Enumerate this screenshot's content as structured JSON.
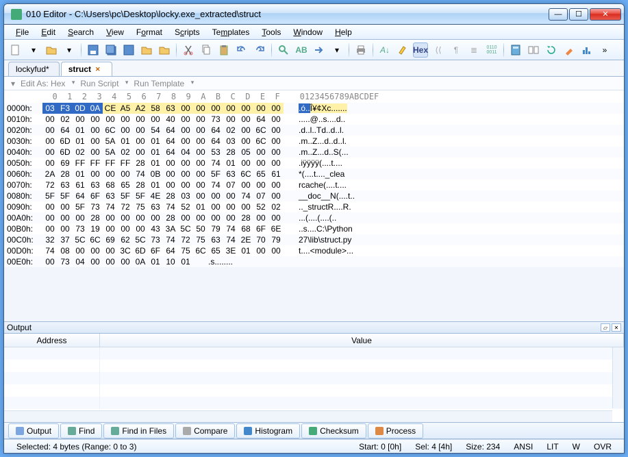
{
  "title": "010 Editor - C:\\Users\\pc\\Desktop\\locky.exe_extracted\\struct",
  "menu": [
    "File",
    "Edit",
    "Search",
    "View",
    "Format",
    "Scripts",
    "Templates",
    "Tools",
    "Window",
    "Help"
  ],
  "tabs": [
    {
      "label": "lockyfud*",
      "active": false,
      "close": true
    },
    {
      "label": "struct",
      "active": true,
      "close": true
    }
  ],
  "options": {
    "editAs": "Edit As: Hex",
    "runScript": "Run Script",
    "runTemplate": "Run Template"
  },
  "hexHeader": "  0  1  2  3  4  5  6  7  8  9  A  B  C  D  E  F    0123456789ABCDEF",
  "hex": [
    {
      "addr": "0000h:",
      "bytes": [
        "03",
        "F3",
        "0D",
        "0A",
        "CE",
        "A5",
        "A2",
        "58",
        "63",
        "00",
        "00",
        "00",
        "00",
        "00",
        "00",
        "00"
      ],
      "ascii": ".ó..Î¥¢Xc......."
    },
    {
      "addr": "0010h:",
      "bytes": [
        "00",
        "02",
        "00",
        "00",
        "00",
        "00",
        "00",
        "00",
        "40",
        "00",
        "00",
        "73",
        "00",
        "00",
        "64",
        "00"
      ],
      "ascii": ".....@..s....d.."
    },
    {
      "addr": "0020h:",
      "bytes": [
        "00",
        "64",
        "01",
        "00",
        "6C",
        "00",
        "00",
        "54",
        "64",
        "00",
        "00",
        "64",
        "02",
        "00",
        "6C",
        "00"
      ],
      "ascii": ".d..l..Td..d..l."
    },
    {
      "addr": "0030h:",
      "bytes": [
        "00",
        "6D",
        "01",
        "00",
        "5A",
        "01",
        "00",
        "01",
        "64",
        "00",
        "00",
        "64",
        "03",
        "00",
        "6C",
        "00"
      ],
      "ascii": ".m..Z...d..d..l."
    },
    {
      "addr": "0040h:",
      "bytes": [
        "00",
        "6D",
        "02",
        "00",
        "5A",
        "02",
        "00",
        "01",
        "64",
        "04",
        "00",
        "53",
        "28",
        "05",
        "00",
        "00"
      ],
      "ascii": ".m..Z...d..S(..."
    },
    {
      "addr": "0050h:",
      "bytes": [
        "00",
        "69",
        "FF",
        "FF",
        "FF",
        "FF",
        "28",
        "01",
        "00",
        "00",
        "00",
        "74",
        "01",
        "00",
        "00",
        "00"
      ],
      "ascii": ".iÿÿÿÿ(....t...."
    },
    {
      "addr": "0060h:",
      "bytes": [
        "2A",
        "28",
        "01",
        "00",
        "00",
        "00",
        "74",
        "0B",
        "00",
        "00",
        "00",
        "5F",
        "63",
        "6C",
        "65",
        "61"
      ],
      "ascii": "*(....t...._clea"
    },
    {
      "addr": "0070h:",
      "bytes": [
        "72",
        "63",
        "61",
        "63",
        "68",
        "65",
        "28",
        "01",
        "00",
        "00",
        "00",
        "74",
        "07",
        "00",
        "00",
        "00"
      ],
      "ascii": "rcache(....t...."
    },
    {
      "addr": "0080h:",
      "bytes": [
        "5F",
        "5F",
        "64",
        "6F",
        "63",
        "5F",
        "5F",
        "4E",
        "28",
        "03",
        "00",
        "00",
        "00",
        "74",
        "07",
        "00"
      ],
      "ascii": "__doc__N(....t.."
    },
    {
      "addr": "0090h:",
      "bytes": [
        "00",
        "00",
        "5F",
        "73",
        "74",
        "72",
        "75",
        "63",
        "74",
        "52",
        "01",
        "00",
        "00",
        "00",
        "52",
        "02"
      ],
      "ascii": ".._structR....R."
    },
    {
      "addr": "00A0h:",
      "bytes": [
        "00",
        "00",
        "00",
        "28",
        "00",
        "00",
        "00",
        "00",
        "28",
        "00",
        "00",
        "00",
        "00",
        "28",
        "00",
        "00"
      ],
      "ascii": "...(....(....(.."
    },
    {
      "addr": "00B0h:",
      "bytes": [
        "00",
        "00",
        "73",
        "19",
        "00",
        "00",
        "00",
        "43",
        "3A",
        "5C",
        "50",
        "79",
        "74",
        "68",
        "6F",
        "6E"
      ],
      "ascii": "..s....C:\\Python"
    },
    {
      "addr": "00C0h:",
      "bytes": [
        "32",
        "37",
        "5C",
        "6C",
        "69",
        "62",
        "5C",
        "73",
        "74",
        "72",
        "75",
        "63",
        "74",
        "2E",
        "70",
        "79"
      ],
      "ascii": "27\\lib\\struct.py"
    },
    {
      "addr": "00D0h:",
      "bytes": [
        "74",
        "08",
        "00",
        "00",
        "00",
        "3C",
        "6D",
        "6F",
        "64",
        "75",
        "6C",
        "65",
        "3E",
        "01",
        "00",
        "00"
      ],
      "ascii": "t....<module>..."
    },
    {
      "addr": "00E0h:",
      "bytes": [
        "00",
        "73",
        "04",
        "00",
        "00",
        "00",
        "0A",
        "01",
        "10",
        "01"
      ],
      "ascii": ".s........"
    }
  ],
  "outputTitle": "Output",
  "outputCols": {
    "addr": "Address",
    "value": "Value"
  },
  "bottomTabs": [
    "Output",
    "Find",
    "Find in Files",
    "Compare",
    "Histogram",
    "Checksum",
    "Process"
  ],
  "status": {
    "selected": "Selected: 4 bytes (Range: 0 to 3)",
    "start": "Start: 0 [0h]",
    "sel": "Sel: 4 [4h]",
    "size": "Size: 234",
    "enc": "ANSI",
    "end": "LIT",
    "w": "W",
    "ovr": "OVR"
  }
}
